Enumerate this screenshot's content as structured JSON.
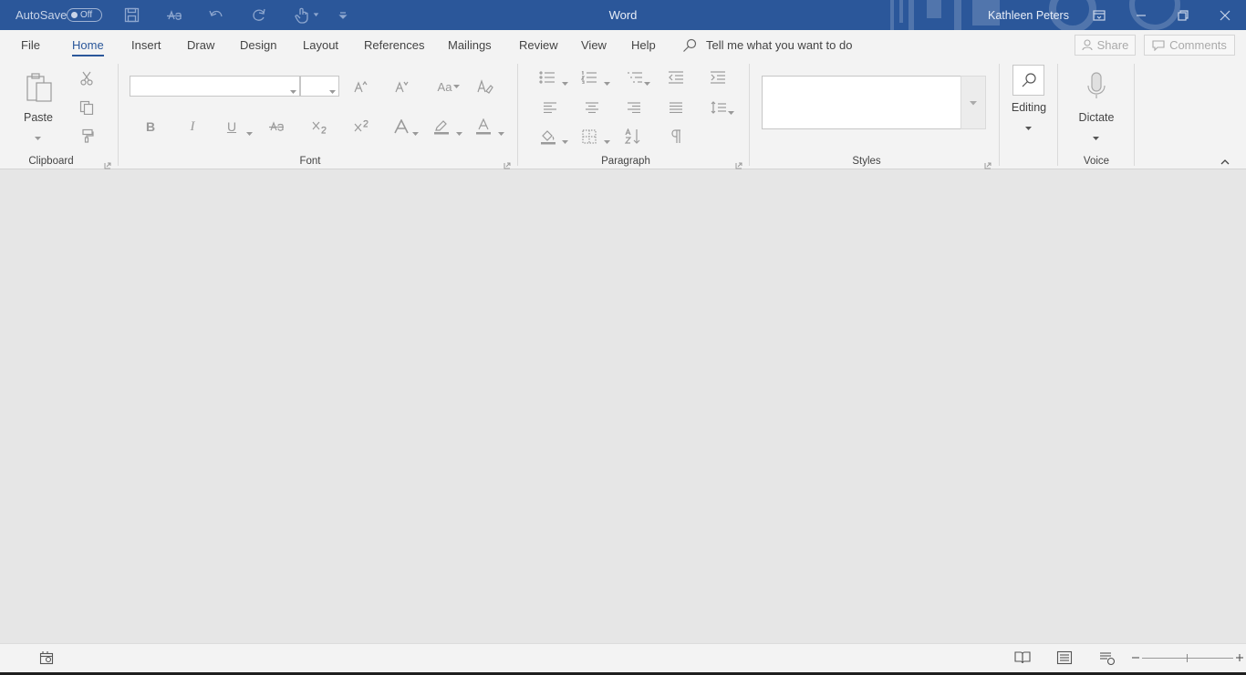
{
  "titlebar": {
    "autosave_label": "AutoSave",
    "autosave_state": "Off",
    "app_title": "Word",
    "user_name": "Kathleen Peters"
  },
  "tabs": [
    {
      "label": "File"
    },
    {
      "label": "Home"
    },
    {
      "label": "Insert"
    },
    {
      "label": "Draw"
    },
    {
      "label": "Design"
    },
    {
      "label": "Layout"
    },
    {
      "label": "References"
    },
    {
      "label": "Mailings"
    },
    {
      "label": "Review"
    },
    {
      "label": "View"
    },
    {
      "label": "Help"
    }
  ],
  "active_tab": "Home",
  "tellme": {
    "placeholder": "Tell me what you want to do"
  },
  "actions": {
    "share": "Share",
    "comments": "Comments"
  },
  "groups": {
    "clipboard": {
      "label": "Clipboard",
      "paste": "Paste"
    },
    "font": {
      "label": "Font",
      "bold": "B",
      "italic": "I",
      "underline": "U",
      "change_case": "Aa"
    },
    "paragraph": {
      "label": "Paragraph"
    },
    "styles": {
      "label": "Styles"
    },
    "editing": {
      "label": "Editing"
    },
    "voice": {
      "label": "Voice",
      "dictate": "Dictate"
    }
  },
  "colors": {
    "titlebar": "#2b579a",
    "ribbon": "#f3f3f3",
    "document_area": "#e6e6e6",
    "accent": "#2b579a"
  }
}
